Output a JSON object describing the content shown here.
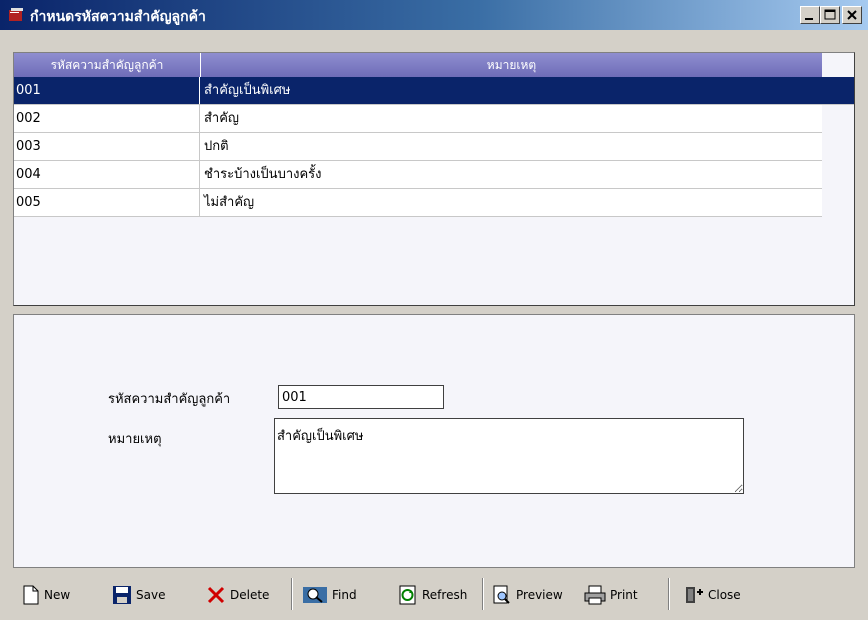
{
  "window": {
    "title": "กำหนดรหัสความสำคัญลูกค้า"
  },
  "grid": {
    "columns": [
      "รหัสความสำคัญลูกค้า",
      "หมายเหตุ"
    ],
    "rows": [
      {
        "code": "001",
        "note": "สำคัญเป็นพิเศษ"
      },
      {
        "code": "002",
        "note": "สำคัญ"
      },
      {
        "code": "003",
        "note": "ปกติ"
      },
      {
        "code": "004",
        "note": "ชำระบ้างเป็นบางครั้ง"
      },
      {
        "code": "005",
        "note": "ไม่สำคัญ"
      }
    ],
    "selected_row": 0
  },
  "form": {
    "code_label": "รหัสความสำคัญลูกค้า",
    "code_value": "001",
    "note_label": "หมายเหตุ",
    "note_value": "สำคัญเป็นพิเศษ"
  },
  "toolbar": {
    "new": "New",
    "save": "Save",
    "delete": "Delete",
    "find": "Find",
    "refresh": "Refresh",
    "preview": "Preview",
    "print": "Print",
    "close": "Close"
  },
  "colors": {
    "title_start": "#0a246a",
    "title_end": "#a6caf0",
    "header": "#7b79c4",
    "selected": "#0a246a"
  }
}
